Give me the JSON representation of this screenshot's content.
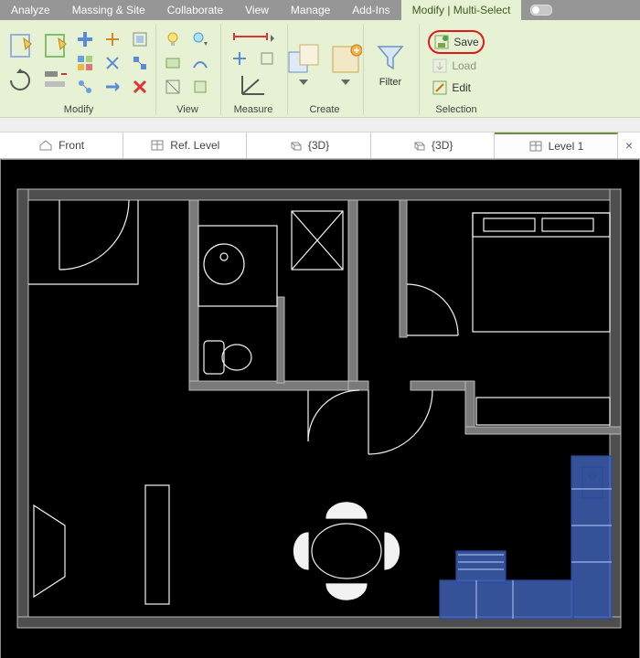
{
  "menu": {
    "tabs": [
      "Analyze",
      "Massing & Site",
      "Collaborate",
      "View",
      "Manage",
      "Add-Ins",
      "Modify | Multi-Select"
    ],
    "active_index": 6
  },
  "ribbon": {
    "panels": {
      "modify": {
        "label": "Modify"
      },
      "view": {
        "label": "View"
      },
      "measure": {
        "label": "Measure"
      },
      "create": {
        "label": "Create"
      },
      "filter": {
        "label": "Filter"
      },
      "selection": {
        "label": "Selection",
        "save": "Save",
        "load": "Load",
        "edit": "Edit"
      }
    }
  },
  "view_tabs": {
    "items": [
      {
        "label": "Front",
        "icon": "home"
      },
      {
        "label": "Ref. Level",
        "icon": "plan"
      },
      {
        "label": "{3D}",
        "icon": "cube"
      },
      {
        "label": "{3D}",
        "icon": "cube"
      },
      {
        "label": "Level 1",
        "icon": "plan"
      }
    ],
    "active_index": 4,
    "close_glyph": "×"
  },
  "canvas": {
    "background": "#000000",
    "wall_stroke": "#b9b9b9",
    "wall_fill_dark": "#4e4e4e",
    "wall_fill_mid": "#7a7a7a",
    "line_stroke": "#f2f2f2",
    "select_fill": "#3e5fb3",
    "select_stroke": "#2b4aa0"
  }
}
